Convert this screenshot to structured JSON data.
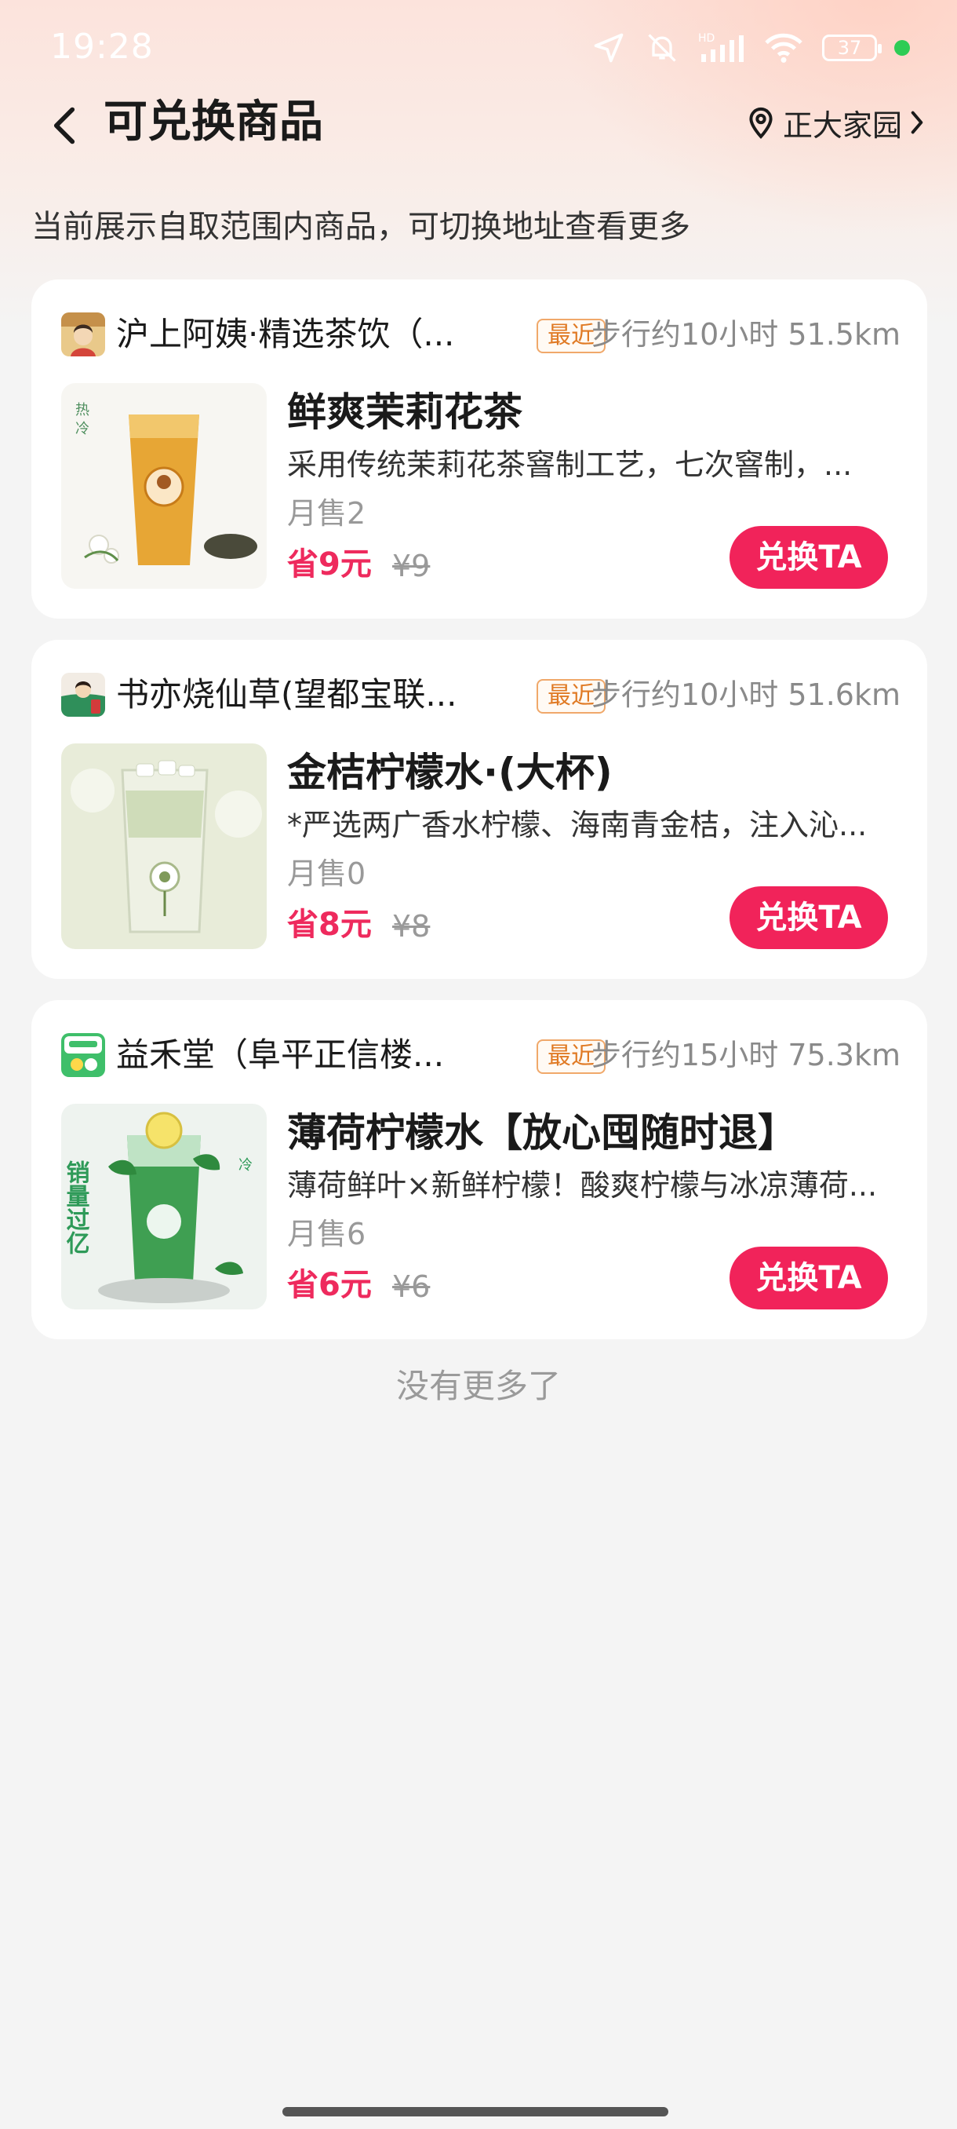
{
  "status_bar": {
    "time": "19:28",
    "battery": "37",
    "icons": [
      "location-arrow-icon",
      "mute-icon",
      "hd-signal-icon",
      "wifi-icon",
      "battery-icon",
      "green-dot-icon"
    ]
  },
  "header": {
    "title": "可兑换商品",
    "location": "正大家园"
  },
  "notice": "当前展示自取范围内商品，可切换地址查看更多",
  "items": [
    {
      "shop_name": "沪上阿姨·精选茶饮（...",
      "badge": "最近",
      "distance": "步行约10小时 51.5km",
      "product_name": "鲜爽茉莉花茶",
      "description": "采用传统茉莉花茶窨制工艺，七次窨制，...",
      "monthly_sales": "月售2",
      "save": "省9元",
      "original_price": "¥9",
      "button": "兑换TA"
    },
    {
      "shop_name": "书亦烧仙草(望都宝联...",
      "badge": "最近",
      "distance": "步行约10小时 51.6km",
      "product_name": "金桔柠檬水·(大杯)",
      "description": "*严选两广香水柠檬、海南青金桔，注入沁...",
      "monthly_sales": "月售0",
      "save": "省8元",
      "original_price": "¥8",
      "button": "兑换TA"
    },
    {
      "shop_name": "益禾堂（阜平正信楼...",
      "badge": "最近",
      "distance": "步行约15小时 75.3km",
      "product_name": "薄荷柠檬水【放心囤随时退】",
      "description": "薄荷鲜叶×新鲜柠檬！酸爽柠檬与冰凉薄荷...",
      "monthly_sales": "月售6",
      "save": "省6元",
      "original_price": "¥6",
      "button": "兑换TA",
      "image_text": "销量过亿"
    }
  ],
  "footer_text": "没有更多了",
  "colors": {
    "accent": "#f1235a",
    "price": "#ee2a5d",
    "badge": "#e07a24",
    "background": "#f4f4f4"
  }
}
